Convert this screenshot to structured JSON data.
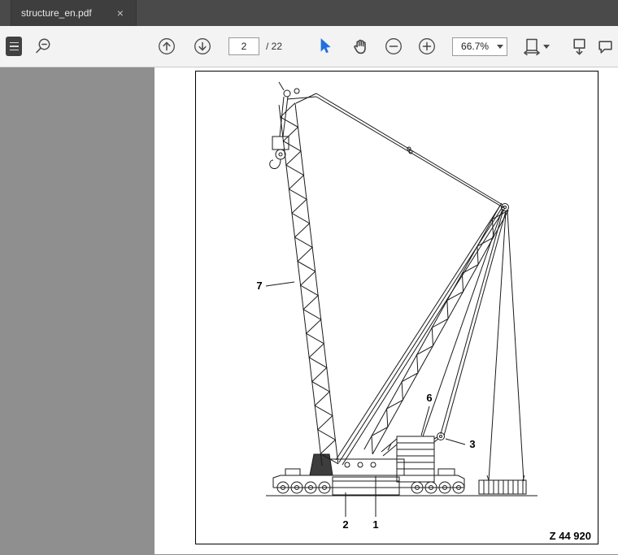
{
  "tab": {
    "title": "structure_en.pdf",
    "close_glyph": "×"
  },
  "toolbar": {
    "page_current": "2",
    "page_total_label": "/ 22",
    "zoom_value": "66.7%"
  },
  "colors": {
    "select_arrow": "#1f6fe0"
  },
  "icons": {
    "sidebar_toggle": "hamburger-dark-square",
    "marquee_zoom": "magnifier-with-minus",
    "previous_page": "circle-arrow-up",
    "next_page": "circle-arrow-down",
    "select_tool": "blue-cursor-arrow",
    "hand_tool": "hand",
    "zoom_out": "circle-minus",
    "zoom_in": "circle-plus",
    "fit_width": "page-with-horizontal-arrows",
    "scroll_mode": "page-with-down-arrow",
    "comment": "speech-bubble"
  },
  "figure": {
    "labels": {
      "n7": "7",
      "n6": "6",
      "n3": "3",
      "n2": "2",
      "n1": "1"
    },
    "code": "Z 44 920"
  }
}
